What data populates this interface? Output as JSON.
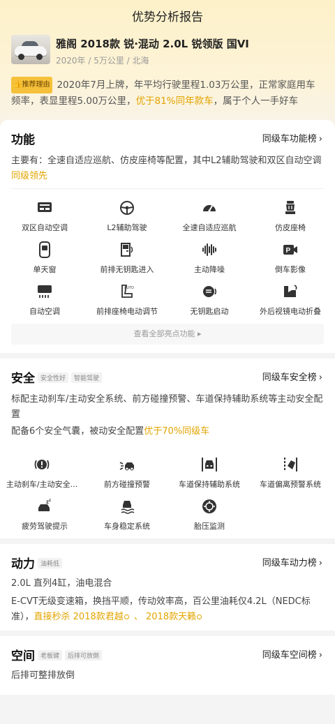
{
  "header": {
    "title": "优势分析报告"
  },
  "car": {
    "name": "雅阁 2018款 锐·混动 2.0L 锐领版 国VI",
    "meta": "2020年 / 5万公里 / 北海"
  },
  "recommend": {
    "badge": "推荐理由",
    "text_a": "2020年7月上牌，年平均行驶里程1.03万公里，正常家庭用车频率，表显里程5.00万公里，",
    "highlight": "优于81%同年款车",
    "text_b": "，属于个人一手好车"
  },
  "function": {
    "title": "功能",
    "link": "同级车功能榜",
    "summary": "主要有：全速自适应巡航、仿皮座椅等配置，其中L2辅助驾驶和双区自动空调",
    "summary_hl": "同级领先",
    "items": [
      {
        "label": "双区自动空调",
        "icon": "ac-panel-icon"
      },
      {
        "label": "L2辅助驾驶",
        "icon": "steering-wheel-icon"
      },
      {
        "label": "全速自适应巡航",
        "icon": "cruise-gauge-icon"
      },
      {
        "label": "仿皮座椅",
        "icon": "seat-icon"
      },
      {
        "label": "单天窗",
        "icon": "sunroof-icon"
      },
      {
        "label": "前排无钥匙进入",
        "icon": "door-keyless-icon"
      },
      {
        "label": "主动降噪",
        "icon": "soundwave-icon"
      },
      {
        "label": "倒车影像",
        "icon": "parking-camera-icon"
      },
      {
        "label": "自动空调",
        "icon": "ac-unit-icon"
      },
      {
        "label": "前排座椅电动调节",
        "icon": "auto-seat-icon"
      },
      {
        "label": "无钥匙启动",
        "icon": "start-button-icon"
      },
      {
        "label": "外后视镜电动折叠",
        "icon": "mirror-fold-icon"
      }
    ],
    "view_all": "查看全部亮点功能 ▸"
  },
  "safety": {
    "title": "安全",
    "tags": [
      "安全性好",
      "智能驾驶"
    ],
    "link": "同级车安全榜",
    "para1": "标配主动刹车/主动安全系统、前方碰撞预警、车道保持辅助系统等主动安全配置",
    "para2_a": "配备6个安全气囊，被动安全配置",
    "para2_hl": "优于70%同级车",
    "items": [
      {
        "label": "主动刹车/主动安全...",
        "icon": "brake-warning-icon"
      },
      {
        "label": "前方碰撞预警",
        "icon": "collision-warning-icon"
      },
      {
        "label": "车道保持辅助系统",
        "icon": "lane-keep-icon"
      },
      {
        "label": "车道偏离预警系统",
        "icon": "lane-departure-icon"
      },
      {
        "label": "疲劳驾驶提示",
        "icon": "fatigue-icon"
      },
      {
        "label": "车身稳定系统",
        "icon": "esp-icon"
      },
      {
        "label": "胎压监测",
        "icon": "tire-pressure-icon"
      }
    ]
  },
  "power": {
    "title": "动力",
    "tags": [
      "油耗低"
    ],
    "link": "同级车动力榜",
    "para1": "2.0L 直列4缸，油电混合",
    "para2_a": "E-CVT无级变速箱，换挡平顺，传动效率高，百公里油耗仅4.2L（NEDC标准），",
    "para2_hl1": "直接秒杀 2018款君越",
    "para2_sep": " 、 ",
    "para2_hl2": "2018款天籁"
  },
  "space": {
    "title": "空间",
    "tags": [
      "老板键",
      "后排可放倒"
    ],
    "link": "同级车空间榜",
    "para1": "后排可整排放倒"
  },
  "colors": {
    "accent": "#e3a400",
    "badge": "#f5c13a",
    "icon": "#333333"
  }
}
